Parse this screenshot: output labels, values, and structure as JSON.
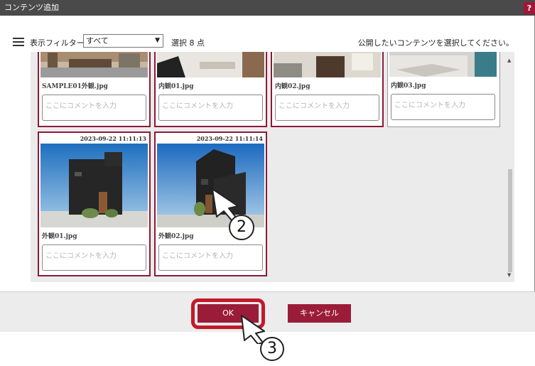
{
  "dialog": {
    "title": "コンテンツ追加",
    "help": "?"
  },
  "toolbar": {
    "filter_label": "表示フィルター",
    "filter_value": "すべて",
    "selected_count": "選択 8 点",
    "instruction": "公開したいコンテンツを選択してください。"
  },
  "cards_top": [
    {
      "filename": "SAMPLE01外観.jpg",
      "comment_placeholder": "ここにコメントを入力",
      "selected": true
    },
    {
      "filename": "内観01.jpg",
      "comment_placeholder": "ここにコメントを入力",
      "selected": true
    },
    {
      "filename": "内観02.jpg",
      "comment_placeholder": "ここにコメントを入力",
      "selected": true
    },
    {
      "filename": "内観03.jpg",
      "comment_placeholder": "ここにコメントを入力",
      "selected": false
    }
  ],
  "cards_bottom": [
    {
      "date": "2023-09-22 11:11:13",
      "filename": "外観01.jpg",
      "comment_placeholder": "ここにコメントを入力",
      "selected": true
    },
    {
      "date": "2023-09-22 11:11:14",
      "filename": "外観02.jpg",
      "comment_placeholder": "ここにコメントを入力",
      "selected": true
    }
  ],
  "buttons": {
    "ok": "OK",
    "cancel": "キャンセル"
  },
  "step_badges": {
    "step2": "2",
    "step3": "3"
  },
  "colors": {
    "accent": "#9b1c38",
    "title_bar": "#4a4a4a",
    "highlight_ring": "#c4192b"
  }
}
